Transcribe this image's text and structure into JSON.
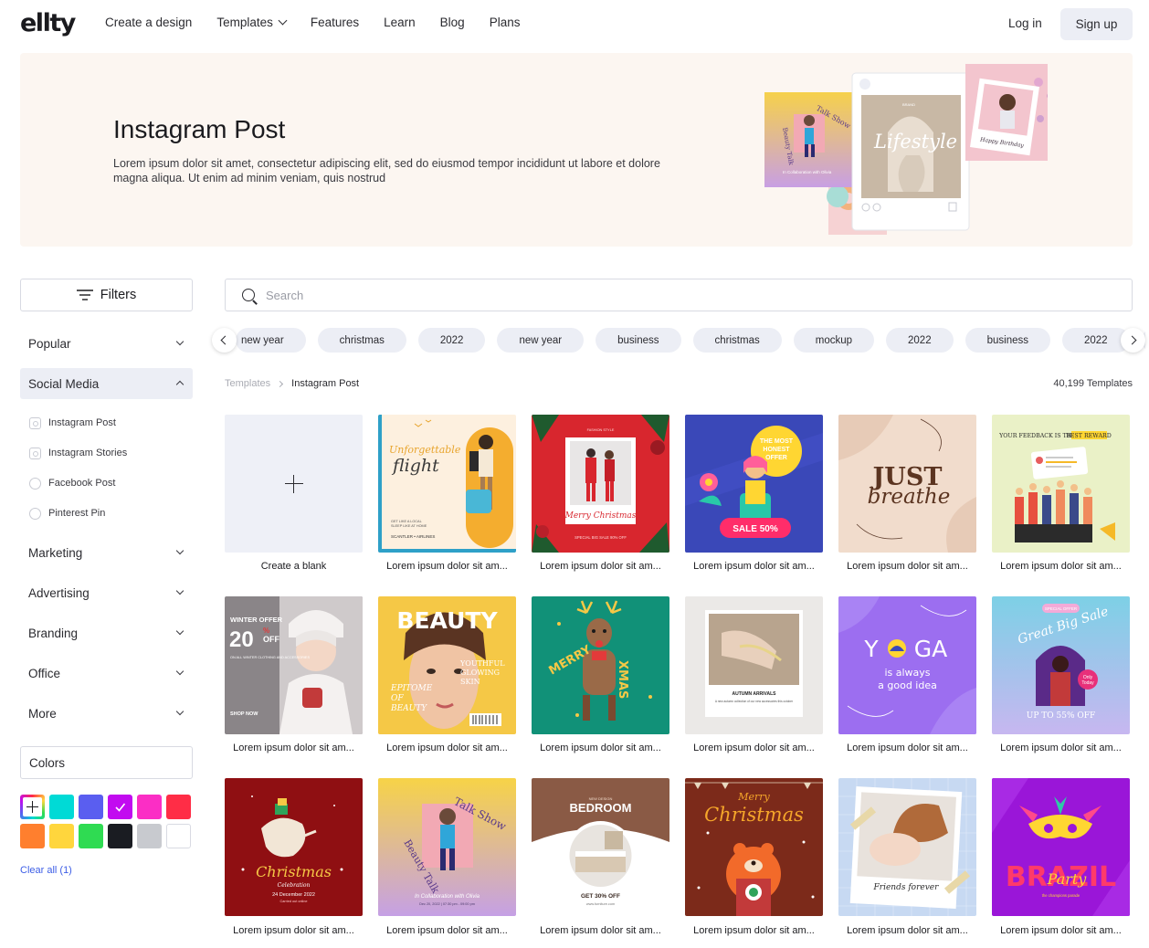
{
  "header": {
    "logo": "ellty",
    "nav": [
      "Create a design",
      "Templates",
      "Features",
      "Learn",
      "Blog",
      "Plans"
    ],
    "login": "Log in",
    "signup": "Sign up"
  },
  "hero": {
    "title": "Instagram Post",
    "description": "Lorem ipsum dolor sit amet, consectetur adipiscing elit, sed do eiusmod tempor incididunt ut labore et dolore magna aliqua. Ut enim ad minim veniam, quis nostrud",
    "art_texts": {
      "talk": "Talk Show",
      "beauty": "Beauty Talk",
      "collab": "In Collaboration with Olivia",
      "lifestyle": "Lifestyle",
      "brand": "BRAND",
      "birthday": "Happy Birthday"
    }
  },
  "sidebar": {
    "filters_label": "Filters",
    "categories": [
      {
        "label": "Popular",
        "open": false
      },
      {
        "label": "Social Media",
        "open": true
      },
      {
        "label": "Marketing",
        "open": false
      },
      {
        "label": "Advertising",
        "open": false
      },
      {
        "label": "Branding",
        "open": false
      },
      {
        "label": "Office",
        "open": false
      },
      {
        "label": "More",
        "open": false
      }
    ],
    "social_items": [
      {
        "label": "Instagram Post",
        "icon": "instagram-icon"
      },
      {
        "label": "Instagram Stories",
        "icon": "instagram-icon"
      },
      {
        "label": "Facebook Post",
        "icon": "facebook-icon"
      },
      {
        "label": "Pinterest Pin",
        "icon": "pinterest-icon"
      }
    ],
    "colors_label": "Colors",
    "swatches": [
      "#00dad6",
      "#5a5ef0",
      "#c20bf0",
      "#fb2ec5",
      "#ff2d46",
      "#ff7f2e",
      "#ffd63d",
      "#2fdb52",
      "#1a1c22",
      "#c8cacf",
      "#ffffff"
    ],
    "clear_all": "Clear all (1)"
  },
  "search": {
    "placeholder": "Search"
  },
  "tags": [
    "new year",
    "christmas",
    "2022",
    "new year",
    "business",
    "christmas",
    "mockup",
    "2022",
    "business",
    "2022",
    "mockup",
    "business"
  ],
  "breadcrumb": {
    "root": "Templates",
    "current": "Instagram Post"
  },
  "template_count": "40,199 Templates",
  "create_blank": "Create a blank",
  "card_caption": "Lorem ipsum dolor sit am...",
  "cards": {
    "c1": {
      "title": "Unforgettable",
      "title2": "flight",
      "tag1": "GET LIKE A LOCAL",
      "tag2": "SLEEP LIKE AT HOME",
      "airline": "SCANTLER • AIRLINES"
    },
    "c2": {
      "top": "FASHION STYLE",
      "script": "Merry Christmas",
      "bottom": "SPECIAL BIG SALE 90% OFF"
    },
    "c3": {
      "line1": "THE MOST",
      "line2": "HONEST",
      "line3": "OFFER",
      "sale": "SALE 50%"
    },
    "c4": {
      "line1": "JUST",
      "line2": "breathe"
    },
    "c5": {
      "line1": "YOUR FEEDBACK IS THE",
      "line2": "BEST REWARD"
    },
    "c6": {
      "line1": "WINTER OFFER",
      "num": "20",
      "pct": "%",
      "off": "OFF",
      "sub": "ON ALL WINTER CLOTHING AND ACCESSORIES",
      "shop": "SHOP NOW"
    },
    "c7": {
      "title": "BEAUTY",
      "r1": "YOUTHFUL",
      "r2": "GLOWING",
      "r3": "SKIN",
      "l1": "EPITOME",
      "l2": "OF",
      "l3": "BEAUTY"
    },
    "c8": {
      "merry": "MERRY",
      "xmas": "XMAS"
    },
    "c9": {
      "title": "AUTUMN ARRIVALS",
      "sub": "A new autumn collection of our new accessories this october"
    },
    "c10": {
      "w1": "Y",
      "w2": "GA",
      "l1": "is always",
      "l2": "a good idea"
    },
    "c11": {
      "badge": "SPECIAL OFFER",
      "arc": "Great Big Sale",
      "only": "Only",
      "today": "Today",
      "bottom": "UP TO 55% OFF"
    },
    "c12": {
      "script": "Christmas",
      "sub": "Celebration",
      "date": "24 December 2022",
      "tiny": "Carried out online"
    },
    "c13": {
      "talk": "Talk Show",
      "beauty": "Beauty Talk",
      "collab": "In Collaboration with Olivia",
      "date": "Dec 20, 2022 | 07:30 pm - 09:00 pm"
    },
    "c14": {
      "tiny": "NEW DESIGN",
      "title": "BEDROOM",
      "offer": "GET 30% OFF",
      "url": "www.furniture.com"
    },
    "c15": {
      "line1": "Merry",
      "line2": "Christmas"
    },
    "c16": {
      "script": "Friends forever"
    },
    "c17": {
      "title": "BRAZIL",
      "script": "Party",
      "sub": "the champions parade"
    }
  }
}
